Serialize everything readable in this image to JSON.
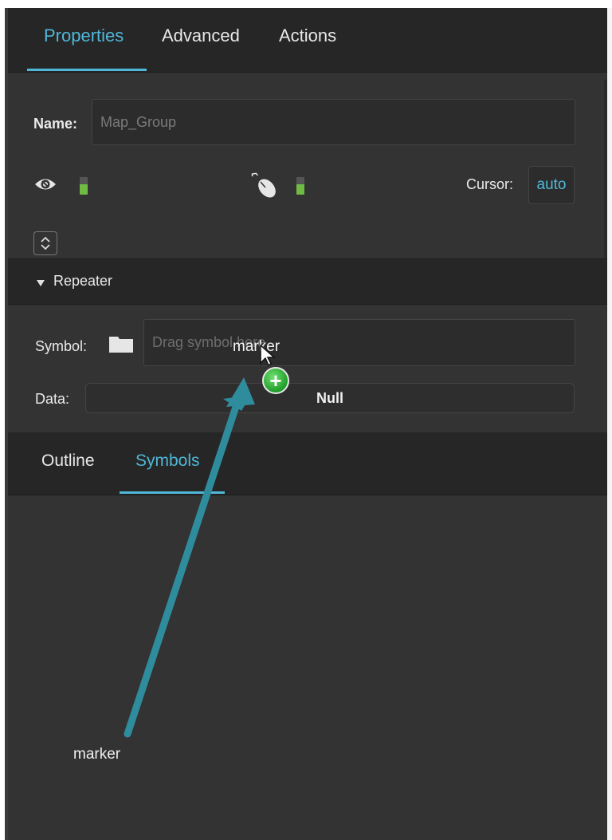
{
  "tabs_top": [
    {
      "label": "Properties",
      "active": true
    },
    {
      "label": "Advanced",
      "active": false
    },
    {
      "label": "Actions",
      "active": false
    }
  ],
  "properties": {
    "name_label": "Name:",
    "name_value": "Map_Group",
    "cursor_label": "Cursor:",
    "cursor_value": "auto"
  },
  "repeater": {
    "section_title": "Repeater",
    "symbol_label": "Symbol:",
    "symbol_placeholder": "Drag symbol here",
    "data_label": "Data:",
    "data_value": "Null"
  },
  "tabs_bottom": [
    {
      "label": "Outline",
      "active": false
    },
    {
      "label": "Symbols",
      "active": true
    }
  ],
  "drag": {
    "dragged_label": "marker",
    "source_label": "marker",
    "plus_symbol": "+"
  },
  "colors": {
    "accent": "#4fb8d8",
    "panel_bg": "#333333",
    "header_bg": "#262626",
    "arrow": "#2e8c9c",
    "toggle_green": "#6fbb43"
  },
  "icons": [
    "eye-icon",
    "mouse-icon",
    "folder-icon",
    "stepper-icon",
    "triangle-down-icon",
    "cursor-arrow-icon",
    "plus-icon"
  ]
}
